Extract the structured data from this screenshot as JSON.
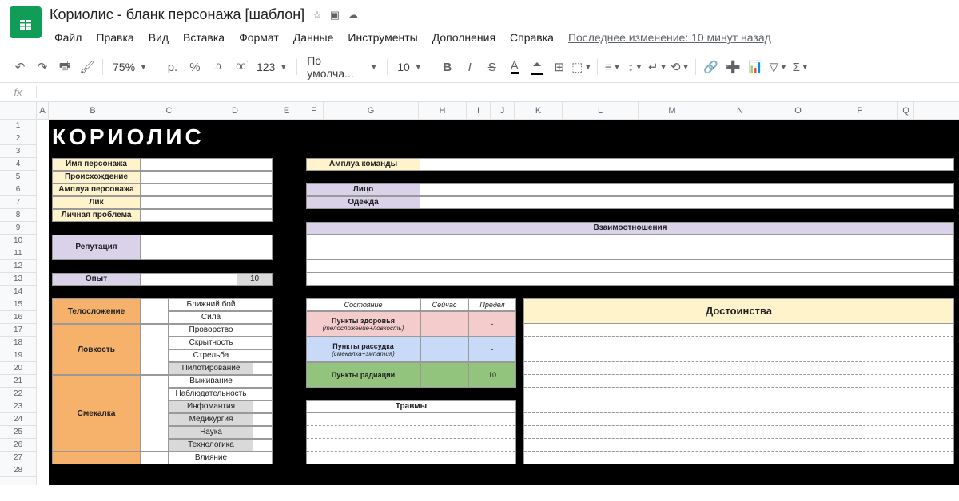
{
  "doc": {
    "title": "Кориолис - бланк персонажа [шаблон]"
  },
  "lastEdit": "Последнее изменение: 10 минут назад",
  "menus": [
    "Файл",
    "Правка",
    "Вид",
    "Вставка",
    "Формат",
    "Данные",
    "Инструменты",
    "Дополнения",
    "Справка"
  ],
  "toolbar": {
    "zoom": "75%",
    "currency": "р.",
    "percent": "%",
    "dec1": ".0",
    "dec2": ".00",
    "fmt": "123",
    "font": "По умолча...",
    "size": "10"
  },
  "cols": [
    "A",
    "B",
    "C",
    "D",
    "E",
    "F",
    "G",
    "H",
    "I",
    "J",
    "K",
    "L",
    "M",
    "N",
    "O",
    "P",
    "Q"
  ],
  "rows": [
    "1",
    "2",
    "3",
    "4",
    "5",
    "6",
    "7",
    "8",
    "9",
    "10",
    "11",
    "12",
    "13",
    "14",
    "15",
    "16",
    "17",
    "18",
    "19",
    "20",
    "21",
    "22",
    "23",
    "24",
    "25",
    "26",
    "27",
    "28"
  ],
  "gameTitle": "КОРИОЛИС",
  "labels": {
    "charName": "Имя персонажа",
    "origin": "Происхождение",
    "role": "Амплуа персонажа",
    "face": "Лик",
    "problem": "Личная проблема",
    "teamRole": "Амплуа команды",
    "faceR": "Лицо",
    "clothes": "Одежда",
    "relations": "Взаимоотношения",
    "reputation": "Репутация",
    "exp": "Опыт",
    "expVal": "10",
    "state": "Состояние",
    "now": "Сейчас",
    "max": "Предел",
    "hp": "Пункты здоровья",
    "hpSub": "(телосложение+ловкость)",
    "mp": "Пункты рассудка",
    "mpSub": "(смекалка+эмпатия)",
    "rad": "Пункты радиации",
    "radVal": "10",
    "dash": "-",
    "merits": "Достоинства",
    "injuries": "Травмы"
  },
  "attrs": [
    {
      "name": "Телосложение",
      "skills": [
        {
          "n": "Ближний бой"
        },
        {
          "n": "Сила"
        }
      ]
    },
    {
      "name": "Ловкость",
      "skills": [
        {
          "n": "Проворство"
        },
        {
          "n": "Скрытность"
        },
        {
          "n": "Стрельба"
        },
        {
          "n": "Пилотирование",
          "g": true
        }
      ]
    },
    {
      "name": "Смекалка",
      "skills": [
        {
          "n": "Выживание"
        },
        {
          "n": "Наблюдательность"
        },
        {
          "n": "Инфомантия",
          "g": true
        },
        {
          "n": "Медикургия",
          "g": true
        },
        {
          "n": "Наука",
          "g": true
        },
        {
          "n": "Технологика",
          "g": true
        }
      ]
    },
    {
      "name": "",
      "skills": [
        {
          "n": "Влияние"
        }
      ]
    }
  ],
  "colWidths": {
    "A": 15,
    "B": 111,
    "C": 80,
    "D": 85,
    "E": 44,
    "F": 24,
    "G": 119,
    "H": 60,
    "I": 30,
    "J": 30,
    "K": 60,
    "L": 95,
    "M": 85,
    "N": 85,
    "O": 60,
    "P": 95,
    "Q": 20
  }
}
